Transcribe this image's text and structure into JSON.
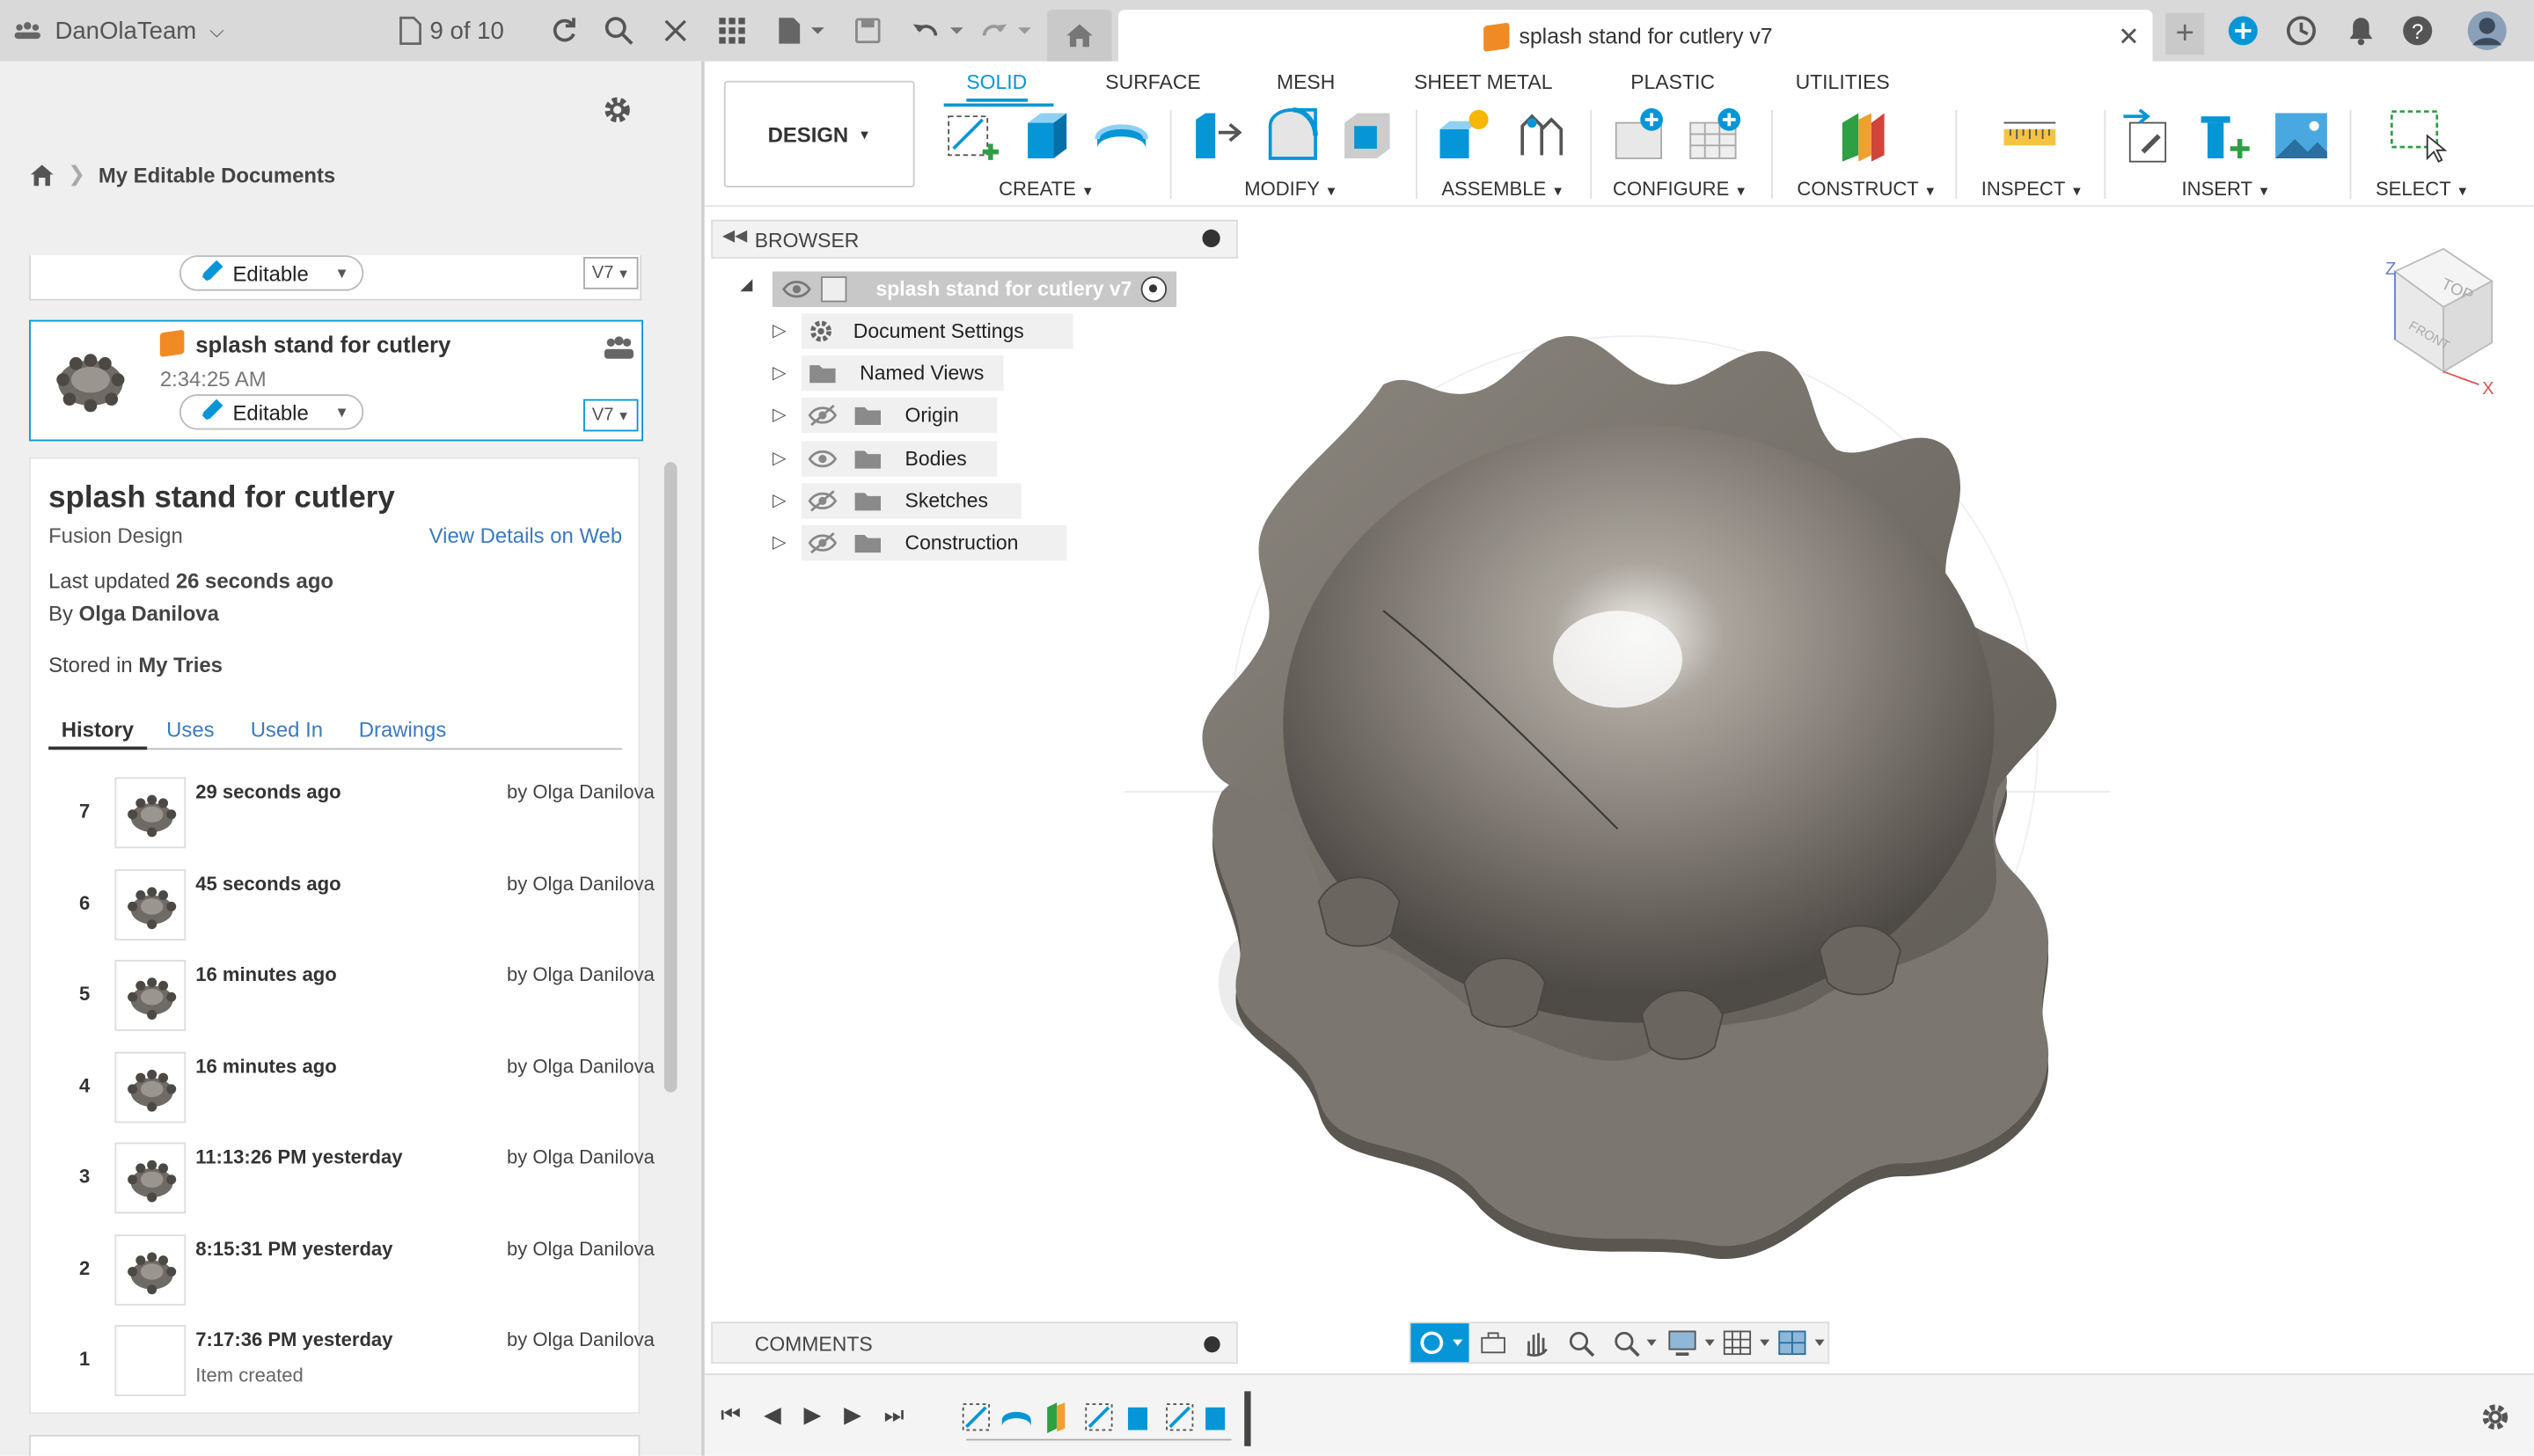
{
  "app": {
    "team_name": "DanOlaTeam",
    "doc_counter": "9 of 10",
    "tab_title": "splash stand for cutlery v7"
  },
  "left": {
    "breadcrumb": "My Editable Documents",
    "prev_card": {
      "status": "Editable",
      "version": "V7"
    },
    "active_card": {
      "title": "splash stand for cutlery",
      "time": "2:34:25 AM",
      "status": "Editable",
      "version": "V7"
    },
    "details": {
      "title": "splash stand for cutlery",
      "subtitle": "Fusion Design",
      "view_link": "View Details on Web",
      "last_updated_label": "Last updated",
      "last_updated_value": "26 seconds ago",
      "by_label": "By",
      "by_value": "Olga Danilova",
      "stored_label": "Stored in",
      "stored_value": "My Tries",
      "tabs": [
        "History",
        "Uses",
        "Used In",
        "Drawings"
      ],
      "history": [
        {
          "num": "7",
          "time": "29 seconds ago",
          "by": "by Olga Danilova",
          "note": ""
        },
        {
          "num": "6",
          "time": "45 seconds ago",
          "by": "by Olga Danilova",
          "note": ""
        },
        {
          "num": "5",
          "time": "16 minutes ago",
          "by": "by Olga Danilova",
          "note": ""
        },
        {
          "num": "4",
          "time": "16 minutes ago",
          "by": "by Olga Danilova",
          "note": ""
        },
        {
          "num": "3",
          "time": "11:13:26 PM yesterday",
          "by": "by Olga Danilova",
          "note": ""
        },
        {
          "num": "2",
          "time": "8:15:31 PM yesterday",
          "by": "by Olga Danilova",
          "note": ""
        },
        {
          "num": "1",
          "time": "7:17:36 PM yesterday",
          "by": "by Olga Danilova",
          "note": "Item created"
        }
      ]
    }
  },
  "toolbar": {
    "workspace": "DESIGN",
    "tabs": [
      "SOLID",
      "SURFACE",
      "MESH",
      "SHEET METAL",
      "PLASTIC",
      "UTILITIES"
    ],
    "groups": [
      "CREATE",
      "MODIFY",
      "ASSEMBLE",
      "CONFIGURE",
      "CONSTRUCT",
      "INSPECT",
      "INSERT",
      "SELECT"
    ]
  },
  "browser": {
    "header": "BROWSER",
    "root": "splash stand for cutlery v7",
    "items": [
      "Document Settings",
      "Named Views",
      "Origin",
      "Bodies",
      "Sketches",
      "Construction"
    ]
  },
  "comments_label": "COMMENTS",
  "viewcube": {
    "top": "TOP",
    "front": "FRONT",
    "z": "Z",
    "x": "X"
  },
  "colors": {
    "accent": "#0696d7",
    "model": "#8a857e"
  }
}
